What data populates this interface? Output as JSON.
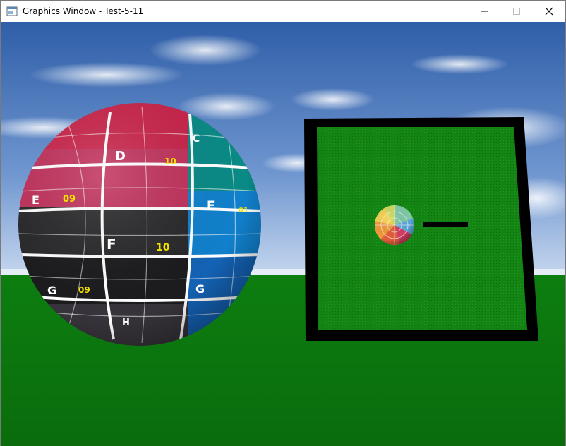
{
  "window": {
    "title": "Graphics Window - Test-5-11",
    "icon": "app-window-icon",
    "controls": [
      "minimize-icon",
      "maximize-icon",
      "close-icon"
    ]
  },
  "scene": {
    "sky_color": "#3e6bb0",
    "ground_color": "#0f7a12",
    "sphere": {
      "row_letters": [
        "D",
        "E",
        "F",
        "G",
        "H"
      ],
      "side_letters": [
        "C",
        "E",
        "G"
      ],
      "numbers": [
        "09",
        "10",
        "01"
      ],
      "number_color": "#f2e200",
      "bands": [
        "#d02a50",
        "#2e2e2e",
        "#1a1a1a",
        "#0d74c2",
        "#0a8a86"
      ]
    },
    "board": {
      "surface_color": "#148414",
      "frame_color": "#000000"
    }
  }
}
